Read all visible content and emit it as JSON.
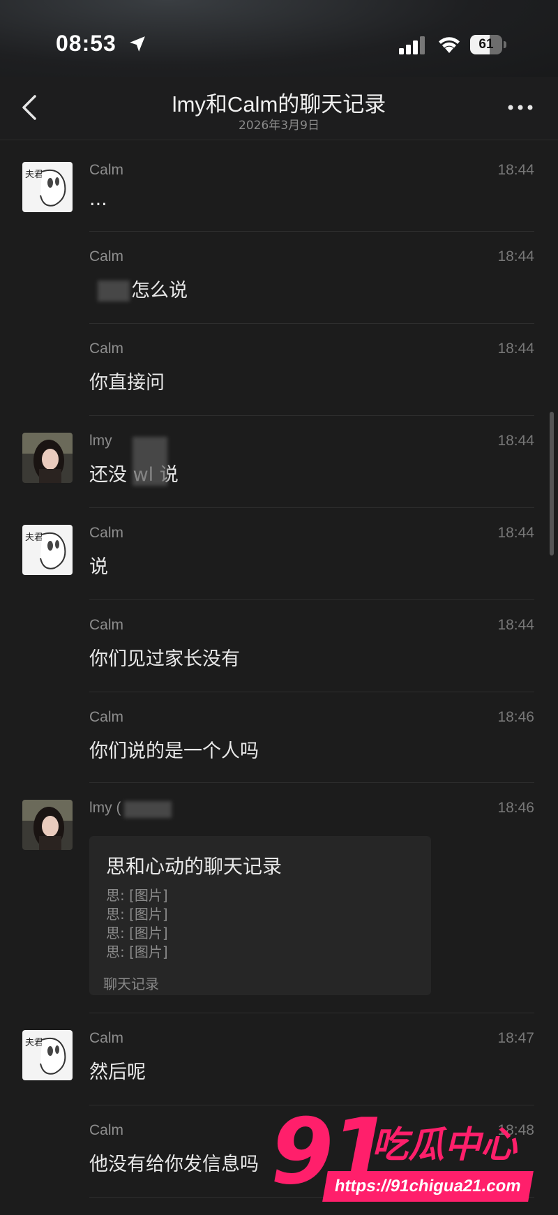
{
  "status_bar": {
    "time": "08:53",
    "battery": "61"
  },
  "header": {
    "title": "lmy和Calm的聊天记录",
    "date": "2026年3月9日"
  },
  "messages": [
    {
      "sender": "Calm",
      "time": "18:44",
      "text": "...",
      "avatar": "calm-avatar"
    },
    {
      "sender": "Calm",
      "time": "18:44",
      "text": "怎么说"
    },
    {
      "sender": "Calm",
      "time": "18:44",
      "text": "你直接问"
    },
    {
      "sender": "lmy",
      "time": "18:44",
      "text": "还没   wl 说",
      "avatar": "lmy-avatar"
    },
    {
      "sender": "Calm",
      "time": "18:44",
      "text": "说",
      "avatar": "calm-avatar"
    },
    {
      "sender": "Calm",
      "time": "18:44",
      "text": "你们见过家长没有"
    },
    {
      "sender": "Calm",
      "time": "18:46",
      "text": "你们说的是一个人吗"
    },
    {
      "sender": "lmy (",
      "time": "18:46",
      "avatar": "lmy-avatar",
      "card": {
        "title": "思和心动的聊天记录",
        "lines": [
          "思: [图片]",
          "思: [图片]",
          "思: [图片]",
          "思: [图片]"
        ],
        "footer": "聊天记录"
      }
    },
    {
      "sender": "Calm",
      "time": "18:47",
      "text": "然后呢",
      "avatar": "calm-avatar"
    },
    {
      "sender": "Calm",
      "time": "18:48",
      "text": "他没有给你发信息吗"
    }
  ],
  "watermark": {
    "number": "91",
    "brand": "吃瓜中心",
    "url": "https://91chigua21.com"
  },
  "colors": {
    "background": "#1c1c1c",
    "watermark": "#ff1f6b"
  }
}
